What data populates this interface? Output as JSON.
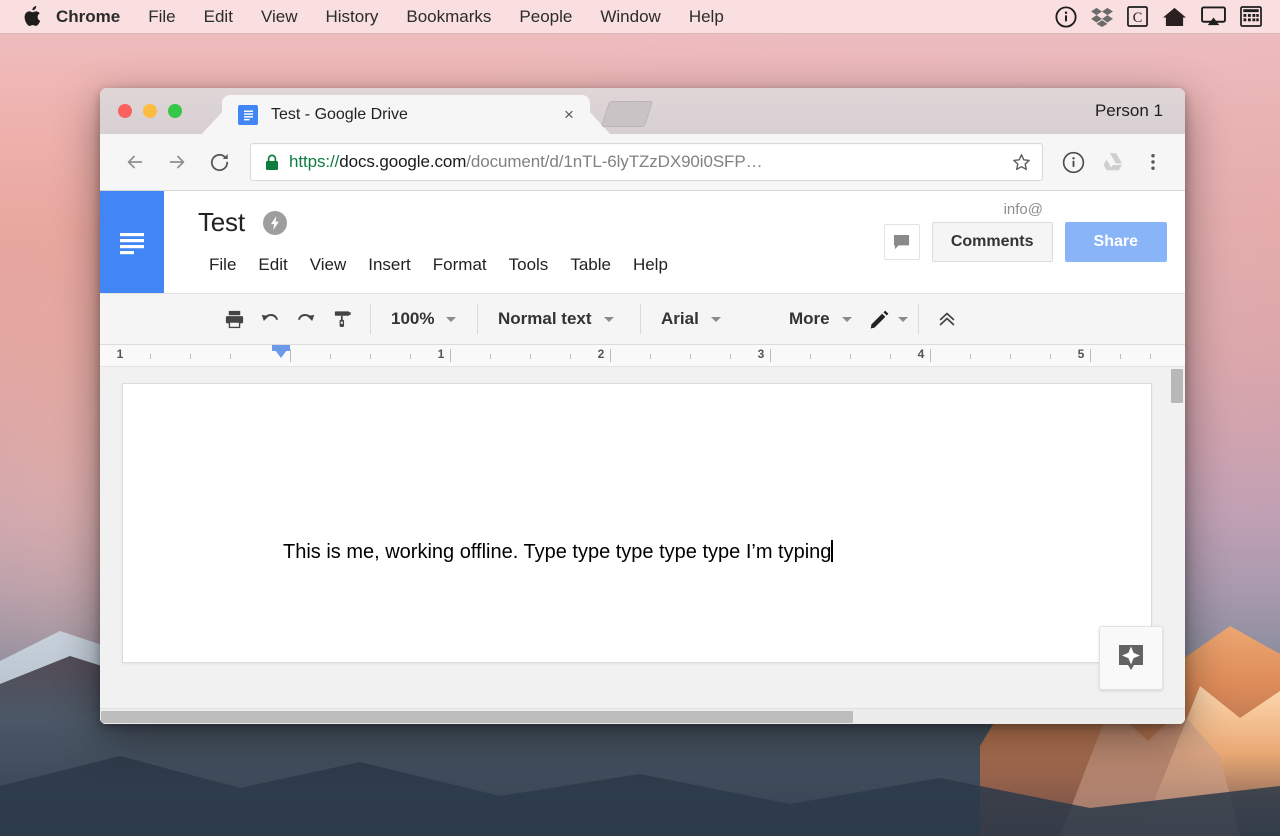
{
  "menubar": {
    "apple_icon": "apple-icon",
    "app_name": "Chrome",
    "items": [
      "File",
      "Edit",
      "View",
      "History",
      "Bookmarks",
      "People",
      "Window",
      "Help"
    ],
    "status_icons": [
      {
        "name": "onepassword-icon",
        "glyph": "1password"
      },
      {
        "name": "dropbox-icon",
        "glyph": "dropbox"
      },
      {
        "name": "creative-cloud-icon",
        "glyph": "C"
      },
      {
        "name": "home-icon",
        "glyph": "house"
      },
      {
        "name": "airplay-icon",
        "glyph": "airplay"
      },
      {
        "name": "calculator-icon",
        "glyph": "grid"
      }
    ]
  },
  "browser": {
    "tab": {
      "title": "Test - Google Drive",
      "favicon": "google-docs-favicon",
      "close_label": "×"
    },
    "new_tab_label": "",
    "profile_label": "Person 1",
    "nav": {
      "back": "back-arrow",
      "forward": "forward-arrow",
      "reload": "reload-icon"
    },
    "omnibox": {
      "lock": "secure-lock-icon",
      "url_scheme": "https://",
      "url_host": "docs.google.com",
      "url_path": "/document/d/1nTL-6lyTZzDX90i0SFP…",
      "star": "bookmark-star-icon"
    },
    "extensions": [
      {
        "name": "onepassword-extension-icon"
      },
      {
        "name": "google-drive-extension-icon"
      },
      {
        "name": "chrome-menu-icon"
      }
    ]
  },
  "docs": {
    "logo": "google-docs-logo",
    "title": "Test",
    "offline_badge": "offline-bolt-icon",
    "menu_items": [
      "File",
      "Edit",
      "View",
      "Insert",
      "Format",
      "Tools",
      "Table",
      "Help"
    ],
    "account_label": "info@",
    "comment_icon": "comment-bubble-icon",
    "comments_label": "Comments",
    "share_label": "Share",
    "toolbar": {
      "print": "print-icon",
      "undo": "undo-icon",
      "redo": "redo-icon",
      "paint_format": "paint-format-icon",
      "zoom_value": "100%",
      "style_value": "Normal text",
      "font_value": "Arial",
      "more_label": "More",
      "mode": "edit-pencil-icon",
      "collapse": "collapse-chevrons-icon"
    },
    "ruler": {
      "numbers": [
        "1",
        "1",
        "2",
        "3",
        "4",
        "5"
      ],
      "indent_marker": "left-indent-marker"
    },
    "document": {
      "body_text": "This is me, working offline. Type type type type type I’m typing"
    },
    "explore_button": "explore-star-icon"
  },
  "colors": {
    "docs_blue": "#4285f4",
    "share_blue": "#8ab4f8",
    "lock_green": "#0f7c3f",
    "ruler_marker_blue": "#6c9ae8"
  }
}
